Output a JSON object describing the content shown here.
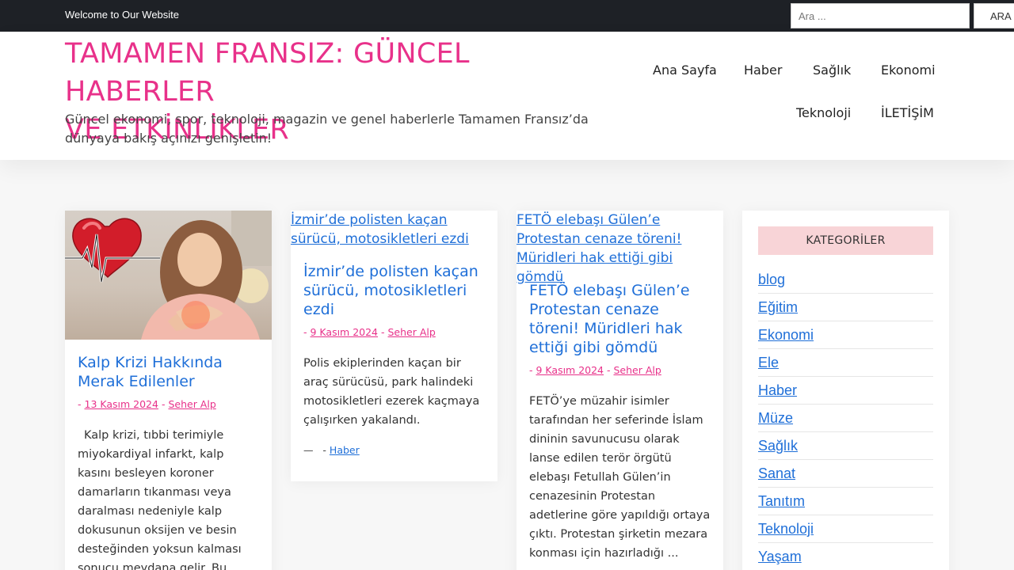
{
  "topbar": {
    "welcome": "Welcome to Our Website",
    "search_placeholder": "Ara ...",
    "search_button": "ARA"
  },
  "header": {
    "title_line1": "TAMAMEN FRANSIZ: GÜNCEL HABERLER",
    "title_line2": "VE ETKİNLİKLER",
    "tagline": "Güncel ekonomi, spor, teknoloji, magazin ve genel haberlerle Tamamen Fransız’da dünyaya bakış açınızı genişletin!"
  },
  "nav": {
    "items": [
      "Ana Sayfa",
      "Haber",
      "Sağlık",
      "Ekonomi",
      "Teknoloji",
      "İLETİŞİM"
    ]
  },
  "posts": [
    {
      "title": "Kalp Krizi Hakkında Merak Edilenler",
      "meta_prefix": "-",
      "date": "13 Kasım 2024",
      "sep": "-",
      "author": "Seher Alp",
      "excerpt": "Kalp krizi, tıbbi terimiyle miyokardiyal infarkt, kalp kasını besleyen koroner damarların tıkanması veya daralması nedeniyle kalp dokusunun oksijen ve besin desteğinden yoksun kalması sonucu meydana gelir. Bu"
    },
    {
      "image_alt": "İzmir’de polisten kaçan sürücü, motosikletleri ezdi",
      "title": "İzmir’de polisten kaçan sürücü, motosikletleri ezdi",
      "meta_prefix": "-",
      "date": "9 Kasım 2024",
      "sep": "-",
      "author": "Seher Alp",
      "excerpt": "Polis ekiplerinden kaçan bir araç sürücüsü, park halindeki motosikletleri ezerek kaçmaya çalışırken yakalandı.",
      "foot_dash": "—",
      "foot_sep": "-",
      "category": "Haber"
    },
    {
      "image_alt": "FETÖ elebaşı Gülen’e Protestan cenaze töreni! Müridleri hak ettiği gibi gömdü",
      "title": "FETÖ elebaşı Gülen’e Protestan cenaze töreni! Müridleri hak ettiği gibi gömdü",
      "meta_prefix": "-",
      "date": "9 Kasım 2024",
      "sep": "-",
      "author": "Seher Alp",
      "excerpt": "FETÖ’ye müzahir isimler tarafından her seferinde İslam dininin savunucusu olarak lanse edilen terör örgütü elebaşı Fetullah Gülen’in cenazesinin Protestan adetlerine göre yapıldığı ortaya çıktı. Protestan şirketin mezara konması için hazırladığı ..."
    }
  ],
  "sidebar": {
    "title": "KATEGORİLER",
    "categories": [
      "blog",
      "Eğitim",
      "Ekonomi",
      "Ele",
      "Haber",
      "Müze",
      "Sağlık",
      "Sanat",
      "Tanıtım",
      "Teknoloji",
      "Yaşam"
    ]
  },
  "colors": {
    "accent": "#e8318a",
    "link": "#1f6fd8",
    "topbar": "#1e2126",
    "widget_title_bg": "#f8d4d7"
  }
}
